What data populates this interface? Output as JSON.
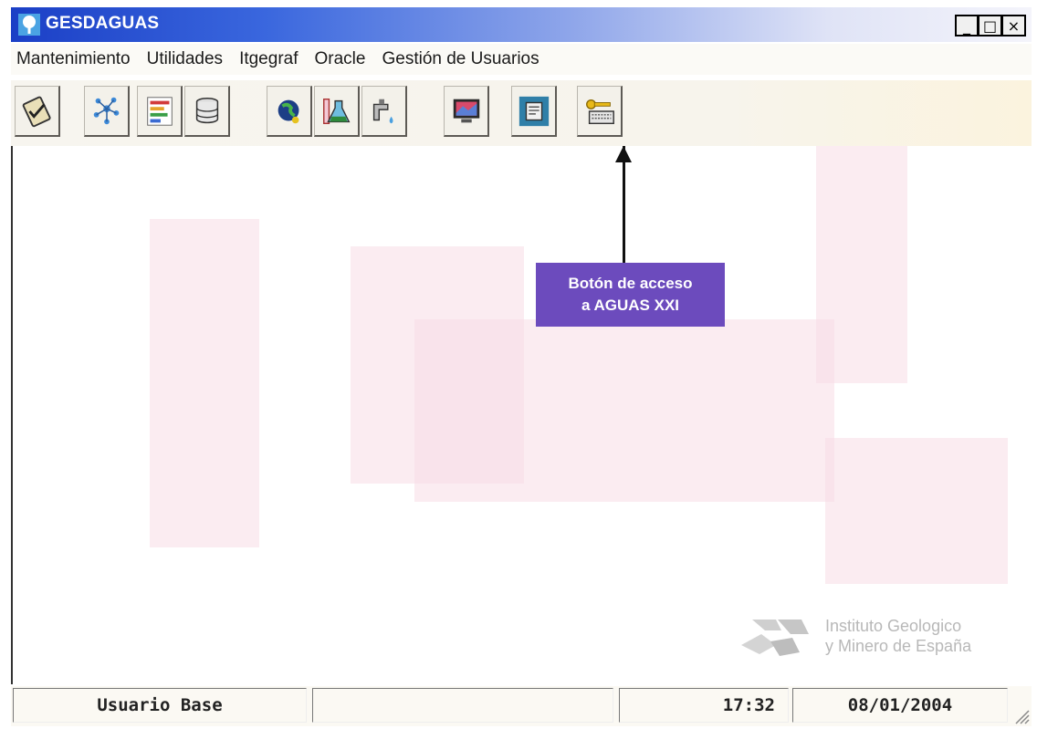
{
  "window": {
    "title": "GESDAGUAS",
    "controls": [
      "minimize-icon",
      "maximize-icon",
      "close-icon"
    ],
    "control_glyphs": [
      "_",
      "□",
      "×"
    ]
  },
  "menu": {
    "items": [
      "Mantenimiento",
      "Utilidades",
      "Itgegraf",
      "Oracle",
      "Gestión de Usuarios"
    ]
  },
  "toolbar": {
    "buttons": [
      {
        "icon": "clipboard-check-icon"
      },
      {
        "icon": "network-tree-icon"
      },
      {
        "icon": "chart-bars-icon"
      },
      {
        "icon": "database-stack-icon"
      },
      {
        "icon": "globe-head-icon"
      },
      {
        "icon": "lab-flask-icon"
      },
      {
        "icon": "water-tap-icon"
      },
      {
        "icon": "map-monitor-icon"
      },
      {
        "icon": "document-window-icon"
      },
      {
        "icon": "key-keyboard-icon"
      }
    ]
  },
  "annotation": {
    "line1": "Botón de acceso",
    "line2": "a AGUAS XXI"
  },
  "logo": {
    "line1": "Instituto Geologico",
    "line2": "y Minero de España"
  },
  "statusbar": {
    "user": "Usuario Base",
    "middle": "",
    "time": "17:32",
    "date": "08/01/2004"
  },
  "colors": {
    "titlebar_start": "#1b3fc6",
    "callout": "#6c4bbd",
    "watermark": "#f7dde6"
  }
}
